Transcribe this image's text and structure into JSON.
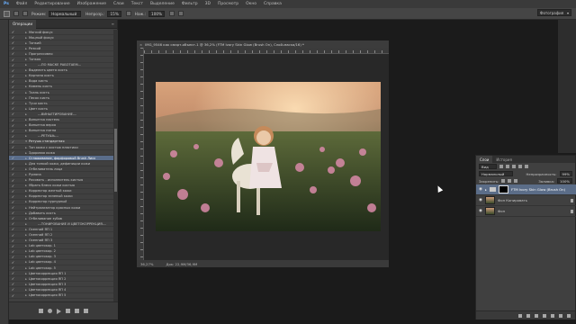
{
  "menubar": {
    "items": [
      "Файл",
      "Редактирование",
      "Изображение",
      "Слои",
      "Текст",
      "Выделение",
      "Фильтр",
      "3D",
      "Просмотр",
      "Окно",
      "Справка"
    ]
  },
  "options": {
    "mode_label": "Режим:",
    "mode_value": "Нормальный",
    "opacity_label": "Непрозр.:",
    "opacity_value": "15%",
    "flow_label": "Наж.:",
    "flow_value": "100%",
    "workspace": "Фотография"
  },
  "actions_panel": {
    "tab": "Операции",
    "rows": [
      {
        "label": "Мягкий фокус",
        "kind": "item"
      },
      {
        "label": "Моцный фокус",
        "kind": "item"
      },
      {
        "label": "Тонкий",
        "kind": "item"
      },
      {
        "label": "Резкий",
        "kind": "item"
      },
      {
        "label": "Прогрессивно",
        "kind": "item"
      },
      {
        "label": "Тонкая",
        "kind": "item"
      },
      {
        "label": "---ПО МАСКЕ РАБОТАЕМ---",
        "kind": "sep"
      },
      {
        "label": "Выделить цвета кисть",
        "kind": "item"
      },
      {
        "label": "Картина кисть",
        "kind": "item"
      },
      {
        "label": "Вода кисть",
        "kind": "item"
      },
      {
        "label": "Камень кисть",
        "kind": "item"
      },
      {
        "label": "Ткань кисть",
        "kind": "item"
      },
      {
        "label": "Песок кисть",
        "kind": "item"
      },
      {
        "label": "Тучи кисть",
        "kind": "item"
      },
      {
        "label": "Цвет кисть",
        "kind": "item"
      },
      {
        "label": "---ВИНЬЕТИРОВАНИЕ---",
        "kind": "sep"
      },
      {
        "label": "Виньетка пастель",
        "kind": "item"
      },
      {
        "label": "Виньетка верха",
        "kind": "item"
      },
      {
        "label": "Виньетка пятна",
        "kind": "item"
      },
      {
        "label": "---РЕТУШЬ---",
        "kind": "sep"
      },
      {
        "label": "Ретушь стандартная",
        "kind": "set"
      },
      {
        "label": "Тон кожи с кистью пластики",
        "kind": "item"
      },
      {
        "label": "Здоровая кожа",
        "kind": "item"
      },
      {
        "label": "Сглаживание, фарфоровый Brush Лиск",
        "kind": "sel"
      },
      {
        "label": "Для тонкой кожи, дефиниции кожи",
        "kind": "item"
      },
      {
        "label": "Отбеливатель лица",
        "kind": "item"
      },
      {
        "label": "Румяна",
        "kind": "item"
      },
      {
        "label": "Рисовать - исполнитель кистью",
        "kind": "item"
      },
      {
        "label": "Убрать блеск кожи кистью",
        "kind": "item"
      },
      {
        "label": "Корректор желтый кожи",
        "kind": "item"
      },
      {
        "label": "Корректор зеленый кожи",
        "kind": "item"
      },
      {
        "label": "Корректор пурпурный",
        "kind": "item"
      },
      {
        "label": "Нейтрализатор красных кожи",
        "kind": "item"
      },
      {
        "label": "Добавить кисть",
        "kind": "item"
      },
      {
        "label": "Отбеливание зубов",
        "kind": "item"
      },
      {
        "label": "---ТОНИРОВАНИЕ И ЦВЕТОКОРРЕКЦИЯ---",
        "kind": "sep"
      },
      {
        "label": "Осенний ЯП 1",
        "kind": "item"
      },
      {
        "label": "Осенний ЯП 2",
        "kind": "item"
      },
      {
        "label": "Осенний ЯП 3",
        "kind": "item"
      },
      {
        "label": "Lab цветокор. 1",
        "kind": "item"
      },
      {
        "label": "Lab цветокор. 2",
        "kind": "item"
      },
      {
        "label": "Lab цветокор. 3",
        "kind": "item"
      },
      {
        "label": "Lab цветокор. 4",
        "kind": "item"
      },
      {
        "label": "Lab цветокор. 5",
        "kind": "item"
      },
      {
        "label": "Цветокоррекция ЯП 1",
        "kind": "item"
      },
      {
        "label": "Цветокоррекция ЯП 2",
        "kind": "item"
      },
      {
        "label": "Цветокоррекция ЯП 3",
        "kind": "item"
      },
      {
        "label": "Цветокоррекция ЯП 4",
        "kind": "item"
      },
      {
        "label": "Цветокоррекция ЯП 5",
        "kind": "item"
      }
    ]
  },
  "document": {
    "title": "IMG_9546 как смарт-объект-1 @ 36,2% (FTM Ivory Skin Glow (Brush On), Слой-маска/16) *",
    "zoom": "36,27%",
    "doc_size": "Док: 22,9М/36,9М"
  },
  "layers_panel": {
    "tabs": [
      "Слои",
      "История"
    ],
    "filter_label": "Вид",
    "blend_mode": "Нормальный",
    "opacity_label": "Непрозрачность:",
    "opacity_value": "99%",
    "lock_label": "Закрепить:",
    "fill_label": "Заливка:",
    "fill_value": "100%",
    "layers": [
      {
        "name": "FTM Ivory Skin Glow (Brush On)",
        "selected": true,
        "group": true
      },
      {
        "name": "Фон Копировать",
        "selected": false,
        "group": false
      },
      {
        "name": "Фон",
        "selected": false,
        "group": false
      }
    ]
  },
  "colors": {
    "selection": "#5a6d8a",
    "panel_bg": "#404040",
    "app_bg": "#1b1b1b"
  }
}
